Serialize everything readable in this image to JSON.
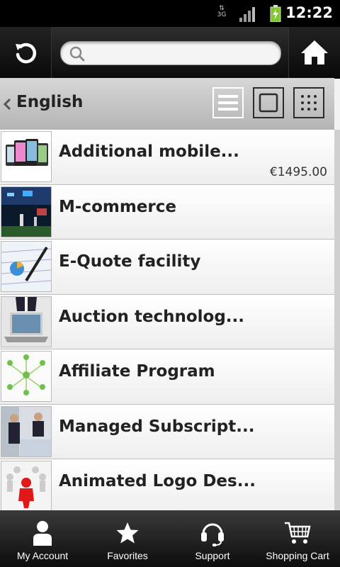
{
  "status_bar": {
    "time": "12:22",
    "network": "3G"
  },
  "toolbar": {
    "refresh_icon": "refresh-icon",
    "search_placeholder": "",
    "home_icon": "home-icon"
  },
  "language_bar": {
    "label": "English",
    "views": [
      "list-view-icon",
      "single-view-icon",
      "grid-view-icon"
    ],
    "selected_view": "list"
  },
  "products": [
    {
      "title": "Additional mobile...",
      "price": "€1495.00"
    },
    {
      "title": "M-commerce",
      "price": ""
    },
    {
      "title": "E-Quote facility",
      "price": ""
    },
    {
      "title": "Auction technolog...",
      "price": ""
    },
    {
      "title": "Affiliate Program",
      "price": ""
    },
    {
      "title": "Managed Subscript...",
      "price": ""
    },
    {
      "title": "Animated Logo Des...",
      "price": ""
    }
  ],
  "bottom_nav": [
    {
      "label": "My Account",
      "icon": "person-icon"
    },
    {
      "label": "Favorites",
      "icon": "star-icon"
    },
    {
      "label": "Support",
      "icon": "headset-icon"
    },
    {
      "label": "Shopping Cart",
      "icon": "cart-icon"
    }
  ],
  "colors": {
    "bar_dark": "#111111",
    "lang_bar": "#c4c4c4",
    "battery": "#7ec82a"
  }
}
